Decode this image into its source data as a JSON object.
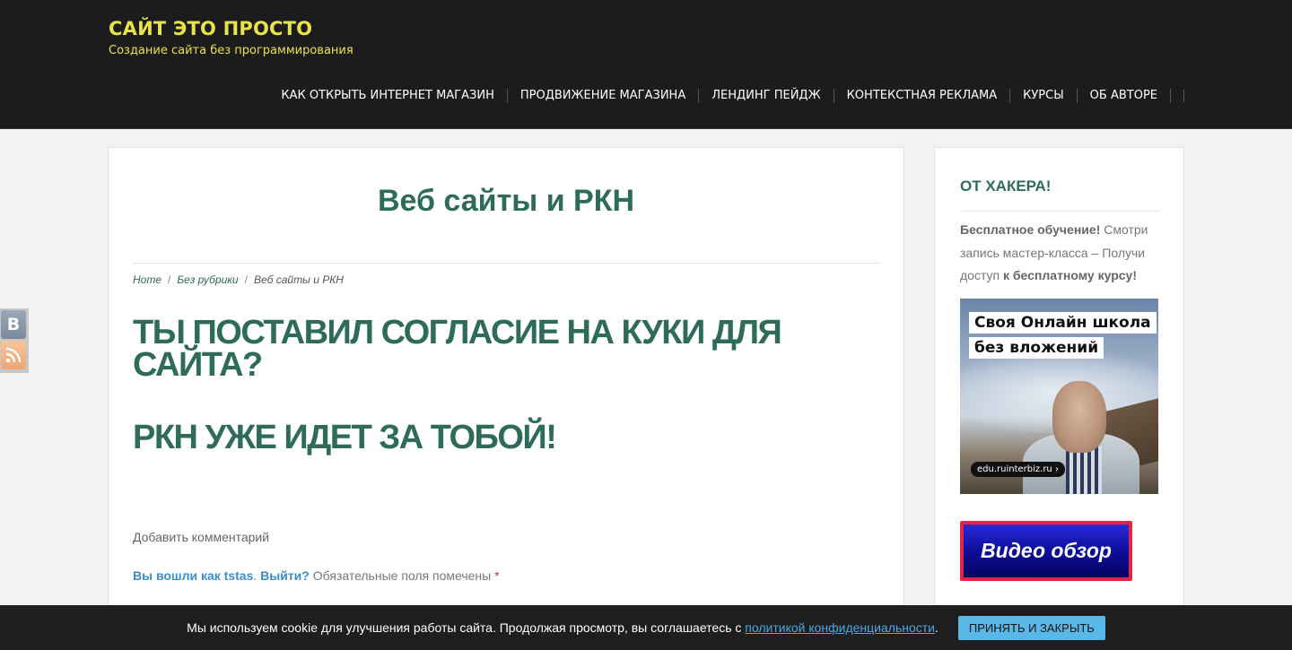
{
  "header": {
    "site_title": "САЙТ ЭТО ПРОСТО",
    "tagline": "Создание сайта без программирования",
    "nav": [
      {
        "label": "КАК ОТКРЫТЬ ИНТЕРНЕТ МАГАЗИН"
      },
      {
        "label": "ПРОДВИЖЕНИЕ МАГАЗИНА"
      },
      {
        "label": "ЛЕНДИНГ ПЕЙДЖ"
      },
      {
        "label": "КОНТЕКСТНАЯ РЕКЛАМА"
      },
      {
        "label": "КУРСЫ"
      },
      {
        "label": "ОБ АВТОРЕ"
      }
    ],
    "colors": {
      "background": "#1c1c1c",
      "title": "#e8e34a"
    }
  },
  "main": {
    "page_title": "Веб сайты и РКН",
    "breadcrumb": [
      {
        "label": "Home"
      },
      {
        "label": "Без рубрики"
      },
      {
        "label": "Веб сайты и РКН"
      }
    ],
    "headline_1": "ТЫ ПОСТАВИЛ СОГЛАСИЕ НА КУКИ ДЛЯ САЙТА?",
    "headline_2": "РКН УЖЕ ИДЕТ ЗА ТОБОЙ!",
    "comment_heading": "Добавить комментарий",
    "logged_in_prefix": "Вы вошли как tstas",
    "logout_label": "Выйти?",
    "required_note": "Обязательные поля помечены",
    "required_mark": "*",
    "accent_color": "#2e6b5b"
  },
  "sidebar": {
    "widget_title": "ОТ ХАКЕРА!",
    "text_bold_1": "Бесплатное обучение!",
    "text_plain": " Смотри запись мастер-класса – Получи доступ ",
    "text_bold_2": "к бесплатному курсу!",
    "promo": {
      "caption_line_1": "Своя Онлайн школа",
      "caption_line_2": "без вложений",
      "url": "edu.ruinterbiz.ru ›"
    },
    "video_button_label": "Видео обзор"
  },
  "social": {
    "vk_icon": "vk-icon",
    "vk_letter": "B",
    "rss_icon": "rss-icon"
  },
  "cookie_bar": {
    "text_before": "Мы используем cookie для улучшения работы сайта. Продолжая просмотр, вы соглашаетесь с ",
    "link_text": "политикой конфиденциальности",
    "text_after": ".",
    "accept_label": "ПРИНЯТЬ И ЗАКРЫТЬ"
  }
}
